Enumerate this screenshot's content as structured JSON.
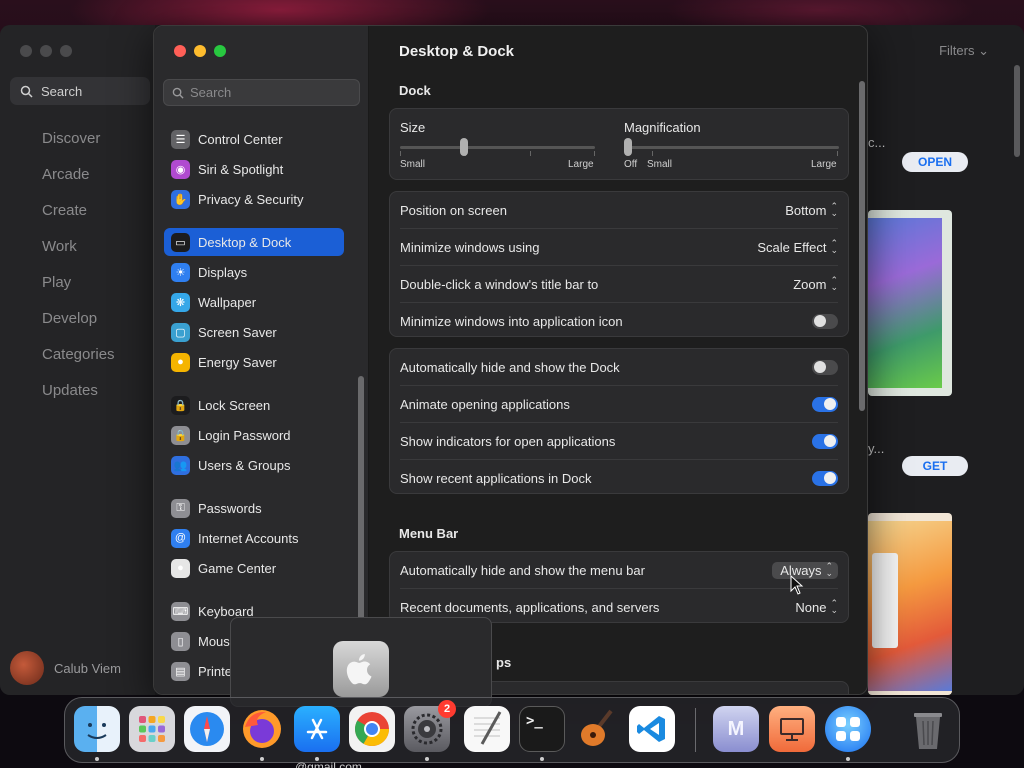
{
  "appstore": {
    "search_label": "Search",
    "nav": [
      "Discover",
      "Arcade",
      "Create",
      "Work",
      "Play",
      "Develop",
      "Categories",
      "Updates"
    ],
    "user_name": "Calub Viem",
    "filters_label": "Filters",
    "open_label": "OPEN",
    "get_label": "GET",
    "frag1": "c...",
    "frag2": "y..."
  },
  "settings": {
    "search_placeholder": "Search",
    "sidebar": [
      {
        "label": "Control Center",
        "color": "#636366",
        "glyph": "☰"
      },
      {
        "label": "Siri & Spotlight",
        "color": "#b04ad0",
        "glyph": "◉"
      },
      {
        "label": "Privacy & Security",
        "color": "#2f6fe0",
        "glyph": "✋"
      },
      {
        "label": "Desktop & Dock",
        "color": "#1c1c1e",
        "glyph": "▭"
      },
      {
        "label": "Displays",
        "color": "#2f7ff0",
        "glyph": "☀"
      },
      {
        "label": "Wallpaper",
        "color": "#35a7e8",
        "glyph": "❋"
      },
      {
        "label": "Screen Saver",
        "color": "#3aa0d0",
        "glyph": "▢"
      },
      {
        "label": "Energy Saver",
        "color": "#f5b400",
        "glyph": "●"
      },
      {
        "label": "Lock Screen",
        "color": "#1c1c1e",
        "glyph": "🔒"
      },
      {
        "label": "Login Password",
        "color": "#8e8e93",
        "glyph": "🔒"
      },
      {
        "label": "Users & Groups",
        "color": "#2f6fe0",
        "glyph": "👥"
      },
      {
        "label": "Passwords",
        "color": "#8e8e93",
        "glyph": "⚿"
      },
      {
        "label": "Internet Accounts",
        "color": "#2f7ff0",
        "glyph": "@"
      },
      {
        "label": "Game Center",
        "color": "#e6e6e6",
        "glyph": "●"
      },
      {
        "label": "Keyboard",
        "color": "#8e8e93",
        "glyph": "⌨"
      },
      {
        "label": "Mous",
        "color": "#8e8e93",
        "glyph": "▯"
      },
      {
        "label": "Printe",
        "color": "#8e8e93",
        "glyph": "▤"
      }
    ],
    "title": "Desktop & Dock",
    "dock_section": "Dock",
    "size_label": "Size",
    "size_small": "Small",
    "size_large": "Large",
    "mag_label": "Magnification",
    "mag_off": "Off",
    "mag_small": "Small",
    "mag_large": "Large",
    "position_label": "Position on screen",
    "position_value": "Bottom",
    "minimize_label": "Minimize windows using",
    "minimize_value": "Scale Effect",
    "dblclick_label": "Double-click a window's title bar to",
    "dblclick_value": "Zoom",
    "minimize_icon_label": "Minimize windows into application icon",
    "autohide_label": "Automatically hide and show the Dock",
    "animate_label": "Animate opening applications",
    "indicators_label": "Show indicators for open applications",
    "recent_label": "Show recent applications in Dock",
    "menubar_section": "Menu Bar",
    "menubar_autohide_label": "Automatically hide and show the menu bar",
    "menubar_autohide_value": "Always",
    "recent_docs_label": "Recent documents, applications, and servers",
    "recent_docs_value": "None",
    "cut_section": "ps"
  },
  "toggles": {
    "minimize_icon": false,
    "autohide": false,
    "animate": true,
    "indicators": true,
    "recent": true
  },
  "dock": {
    "settings_badge": "2",
    "apps": [
      "Finder",
      "Launchpad",
      "Safari",
      "Firefox",
      "App Store",
      "Chrome",
      "System Settings",
      "TextEdit",
      "Terminal",
      "GarageBand",
      "VS Code",
      "Mail",
      "Keynote",
      "Screens",
      "Trash"
    ],
    "mail_letter": "M"
  },
  "bottom_fragment": "...@gmail.com"
}
